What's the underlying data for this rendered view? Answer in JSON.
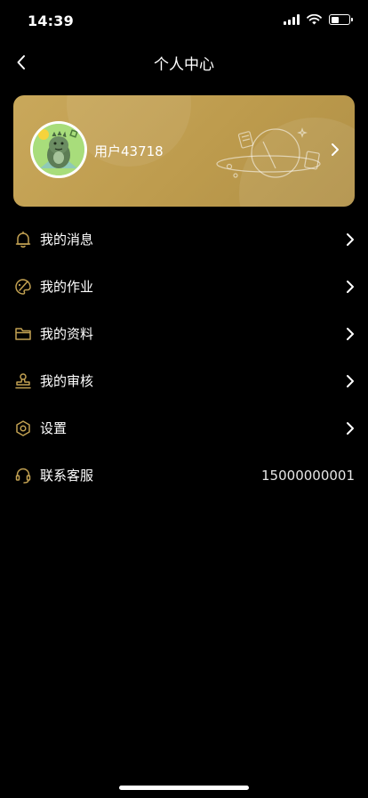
{
  "status_bar": {
    "time": "14:39"
  },
  "header": {
    "title": "个人中心",
    "back_icon": "chevron-left-icon"
  },
  "profile": {
    "username": "用户43718",
    "card_color": "#c2a152"
  },
  "menu": [
    {
      "id": "messages",
      "label": "我的消息",
      "icon": "bell-icon",
      "has_chevron": true
    },
    {
      "id": "homework",
      "label": "我的作业",
      "icon": "palette-icon",
      "has_chevron": true
    },
    {
      "id": "materials",
      "label": "我的资料",
      "icon": "folder-icon",
      "has_chevron": true
    },
    {
      "id": "review",
      "label": "我的审核",
      "icon": "stamp-icon",
      "has_chevron": true
    },
    {
      "id": "settings",
      "label": "设置",
      "icon": "settings-icon",
      "has_chevron": true
    },
    {
      "id": "support",
      "label": "联系客服",
      "icon": "headset-icon",
      "value": "15000000001",
      "has_chevron": false
    }
  ],
  "colors": {
    "background": "#000000",
    "accent_gold": "#c2a152",
    "text": "#ffffff"
  }
}
